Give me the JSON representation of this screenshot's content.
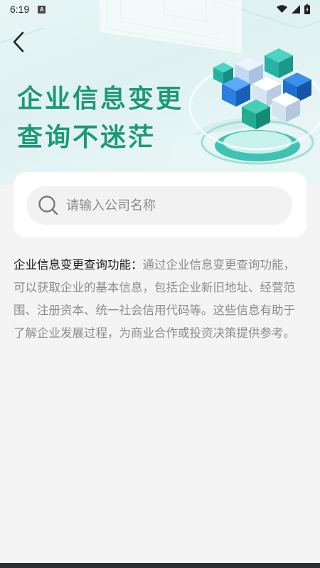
{
  "status_bar": {
    "time": "6:19",
    "notification_badge": "A",
    "icons": [
      "wifi-icon",
      "signal-icon",
      "battery-icon"
    ]
  },
  "header": {
    "back_icon": "chevron-left-icon",
    "title_line1": "企业信息变更",
    "title_line2": "查询不迷茫",
    "accent_color": "#1c9a78"
  },
  "search": {
    "icon": "search-icon",
    "placeholder": "请输入公司名称",
    "value": ""
  },
  "description": {
    "label": "企业信息变更查询功能：",
    "text": "通过企业信息变更查询功能，可以获取企业的基本信息，包括企业新旧地址、经营范围、注册资本、统一社会信用代码等。这些信息有助于了解企业发展过程，为商业合作或投资决策提供参考。"
  }
}
